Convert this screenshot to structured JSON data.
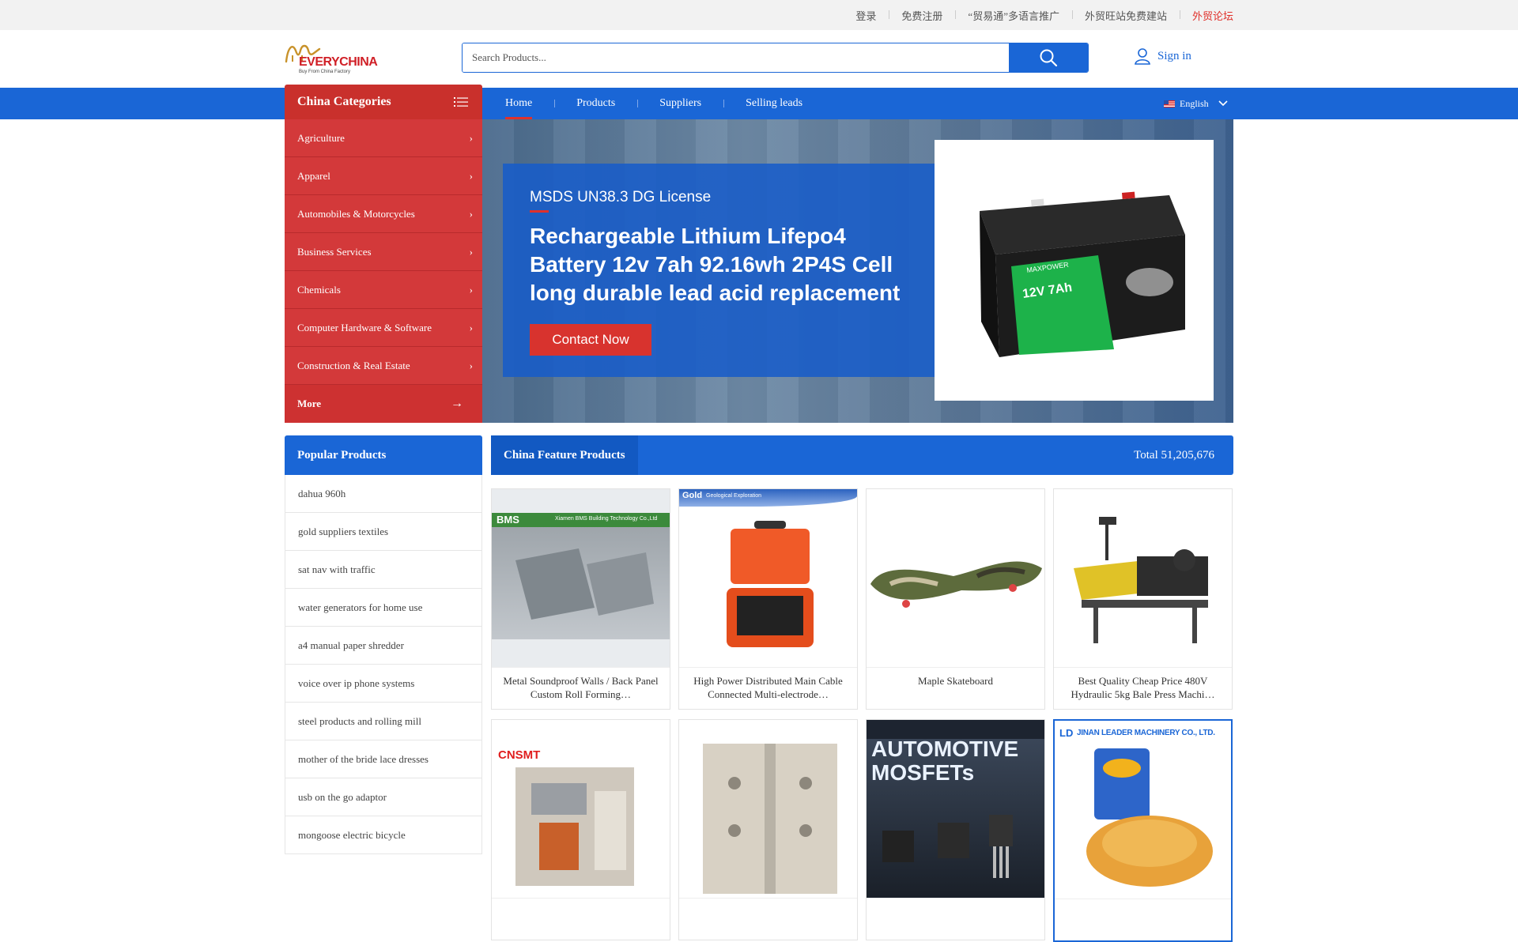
{
  "topbar": {
    "links": [
      "登录",
      "免费注册",
      "“贸易通”多语言推广",
      "外贸旺站免费建站",
      "外贸论坛"
    ]
  },
  "logo": {
    "name": "EVERYCHINA",
    "tagline": "Buy From China Factory"
  },
  "search": {
    "placeholder": "Search Products..."
  },
  "account": {
    "signin_label": "Sign in"
  },
  "nav": {
    "categories_title": "China Categories",
    "links": [
      "Home",
      "Products",
      "Suppliers",
      "Selling leads"
    ],
    "active": "Home",
    "language": "English"
  },
  "categories": [
    "Agriculture",
    "Apparel",
    "Automobiles & Motorcycles",
    "Business Services",
    "Chemicals",
    "Computer Hardware & Software",
    "Construction & Real Estate"
  ],
  "categories_more": "More",
  "banner": {
    "subtitle": "MSDS UN38.3 DG License",
    "title": "Rechargeable Lithium Lifepo4 Battery 12v 7ah 92.16wh 2P4S Cell long durable lead acid replacement",
    "cta": "Contact Now",
    "battery_brand": "MAXPOWER",
    "battery_label": "12V 7Ah"
  },
  "popular": {
    "title": "Popular Products",
    "items": [
      "dahua 960h",
      "gold suppliers textiles",
      "sat nav with traffic",
      "water generators for home use",
      "a4 manual paper shredder",
      "voice over ip phone systems",
      "steel products and rolling mill",
      "mother of the bride lace dresses",
      "usb on the go adaptor",
      "mongoose electric bicycle"
    ]
  },
  "feature": {
    "title": "China Feature Products",
    "total": "Total 51,205,676",
    "products": [
      {
        "caption": "Metal Soundproof Walls / Back Panel Custom Roll Forming…",
        "img_text": "BMS",
        "img_sub": "Xiamen BMS Building Technology Co.,Ltd"
      },
      {
        "caption": "High Power Distributed Main Cable Connected Multi-electrode…",
        "img_text": "Gold",
        "img_sub": "Geological Exploration"
      },
      {
        "caption": "Maple Skateboard",
        "img_text": "",
        "img_sub": ""
      },
      {
        "caption": "Best Quality Cheap Price 480V Hydraulic 5kg Bale Press Machi…",
        "img_text": "",
        "img_sub": ""
      },
      {
        "caption": "",
        "img_text": "CNSMT",
        "img_sub": ""
      },
      {
        "caption": "",
        "img_text": "",
        "img_sub": ""
      },
      {
        "caption": "",
        "img_text": "AUTOMOTIVE MOSFETs",
        "img_sub": ""
      },
      {
        "caption": "",
        "img_text": "JINAN LEADER MACHINERY CO., LTD.",
        "img_sub": "LD"
      }
    ]
  },
  "colors": {
    "primary": "#1a66d6",
    "accent": "#d3393a",
    "link_red": "#e0312b"
  }
}
